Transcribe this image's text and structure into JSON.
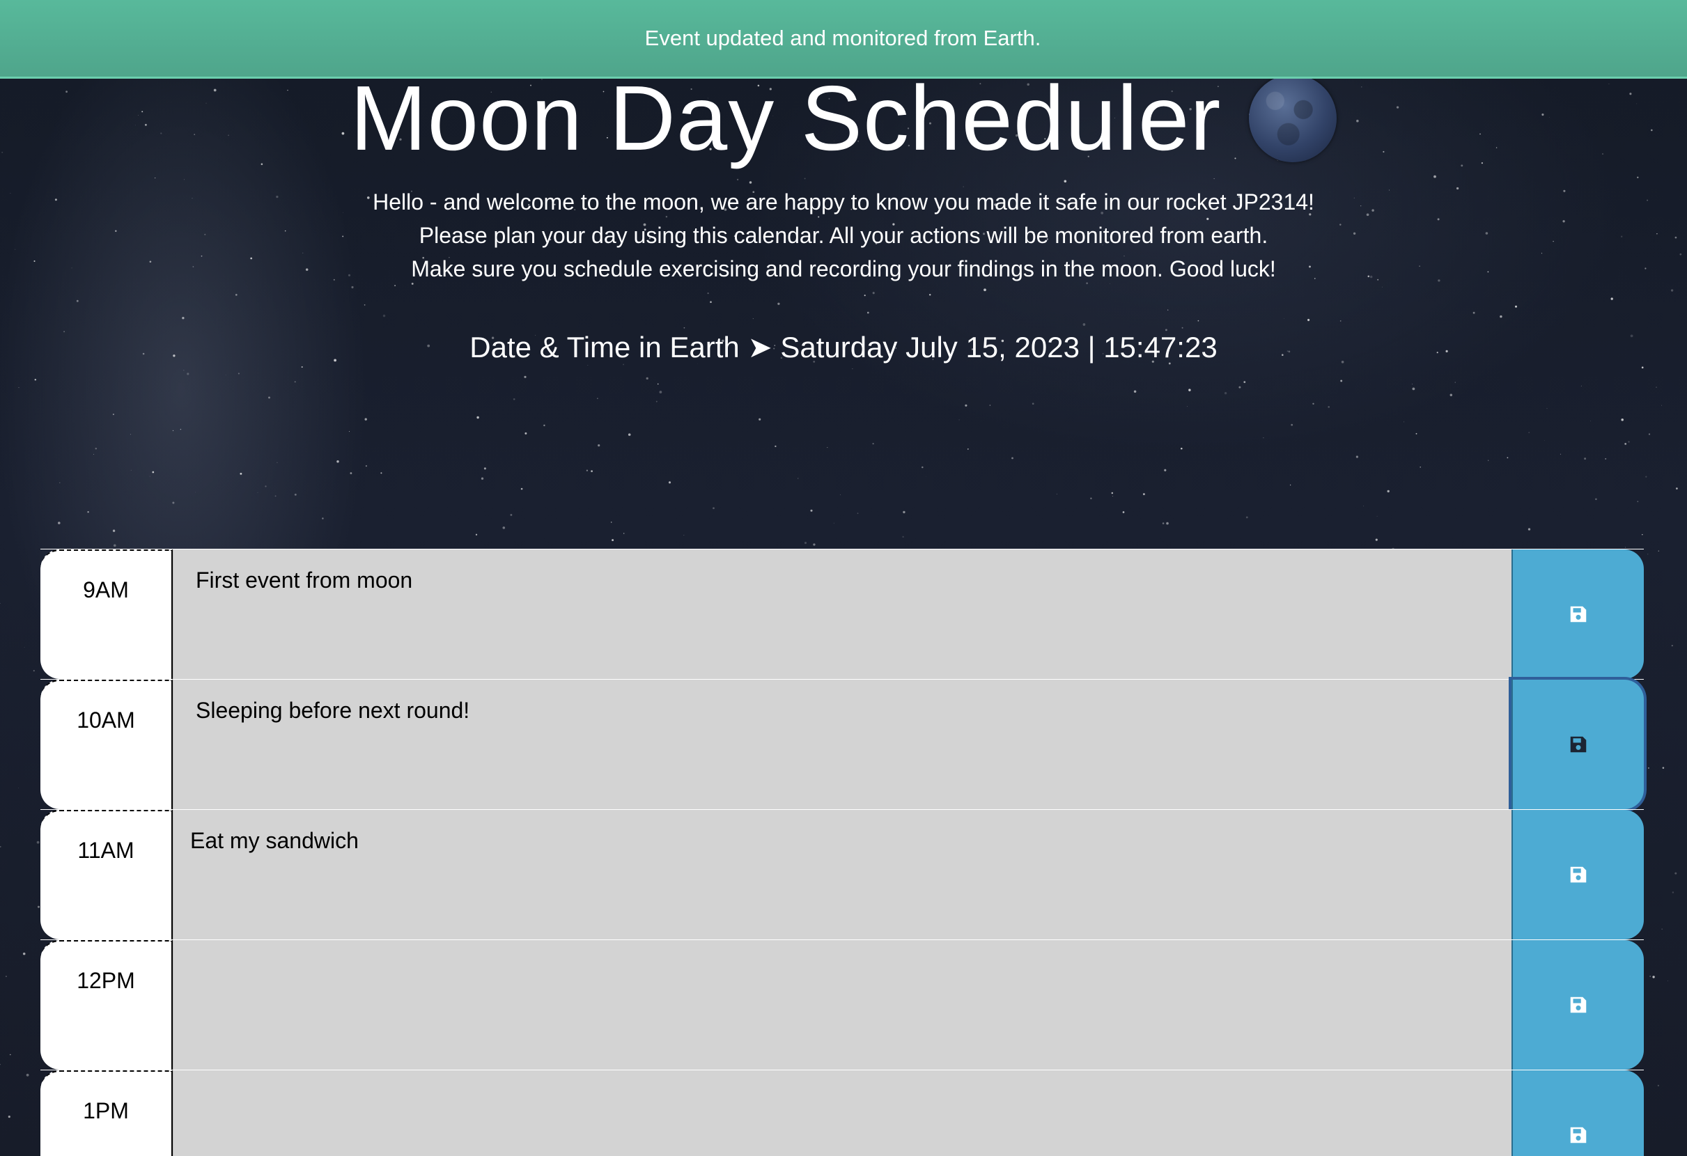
{
  "notification": {
    "text": "Event updated and monitored from Earth."
  },
  "header": {
    "title": "Moon Day Scheduler",
    "intro_lines": [
      "Hello - and welcome to the moon, we are happy to know you made it safe in our rocket JP2314!",
      "Please plan your day using this calendar. All your actions will be monitored from earth.",
      "Make sure you schedule exercising and recording your findings in the moon. Good luck!"
    ],
    "datetime_label": "Date & Time in Earth ➤ Saturday July 15, 2023 | 15:47:23"
  },
  "schedule": {
    "rows": [
      {
        "hour": "9AM",
        "event": "First event from moon"
      },
      {
        "hour": "10AM",
        "event": "Sleeping before next round!"
      },
      {
        "hour": "11AM",
        "event": "Eat my sandwich"
      },
      {
        "hour": "12PM",
        "event": ""
      },
      {
        "hour": "1PM",
        "event": ""
      }
    ]
  },
  "icons": {
    "save": "floppy-disk-icon",
    "moon": "moon-icon"
  },
  "colors": {
    "banner": "#58b99b",
    "event_bg": "#d3d3d3",
    "save_button": "#4dabd3",
    "hour_bg": "#ffffff"
  }
}
